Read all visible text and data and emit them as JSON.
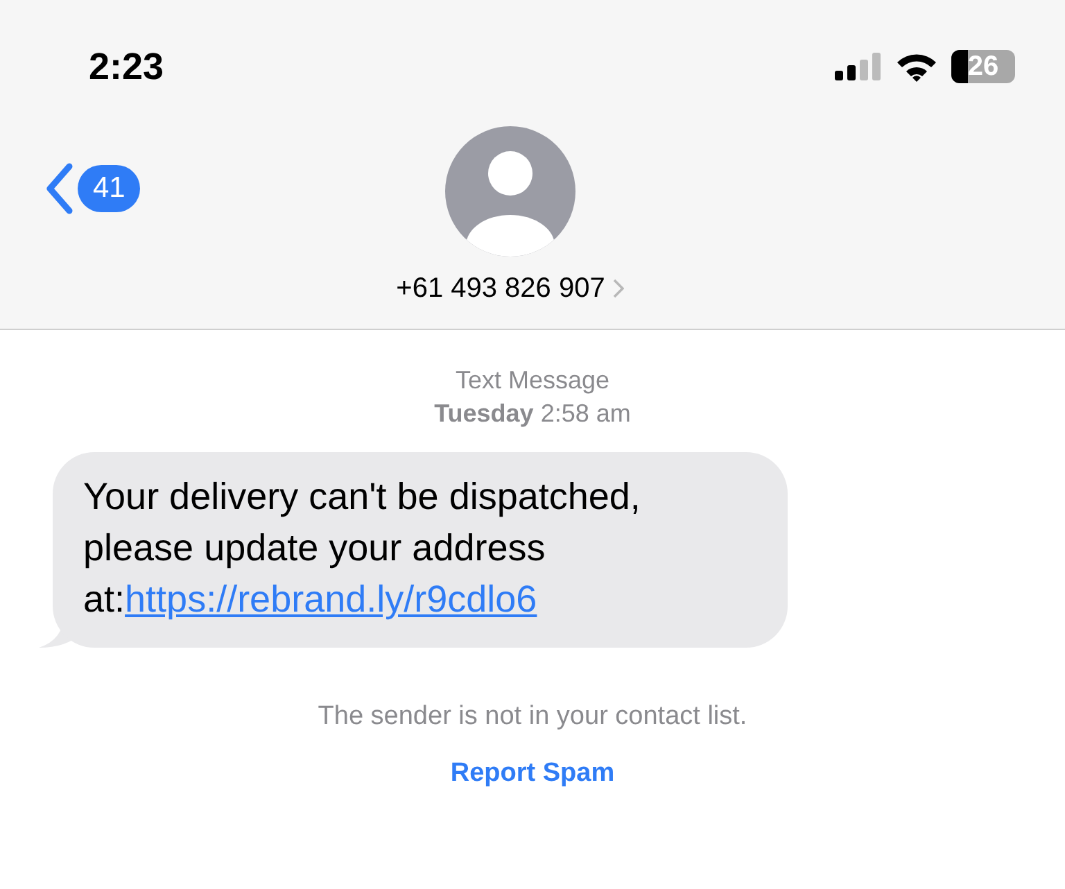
{
  "status_bar": {
    "time": "2:23",
    "battery": "26"
  },
  "header": {
    "back_count": "41",
    "contact": "+61 493 826 907"
  },
  "conversation": {
    "service": "Text Message",
    "day": "Tuesday",
    "time": "2:58 am",
    "messages": [
      {
        "kind": "incoming",
        "text": "Your delivery can't be dispatched, please update your address at:",
        "link": "https://rebrand.ly/r9cdlo6"
      }
    ],
    "notice": "The sender is not in your contact list.",
    "action": "Report Spam"
  }
}
